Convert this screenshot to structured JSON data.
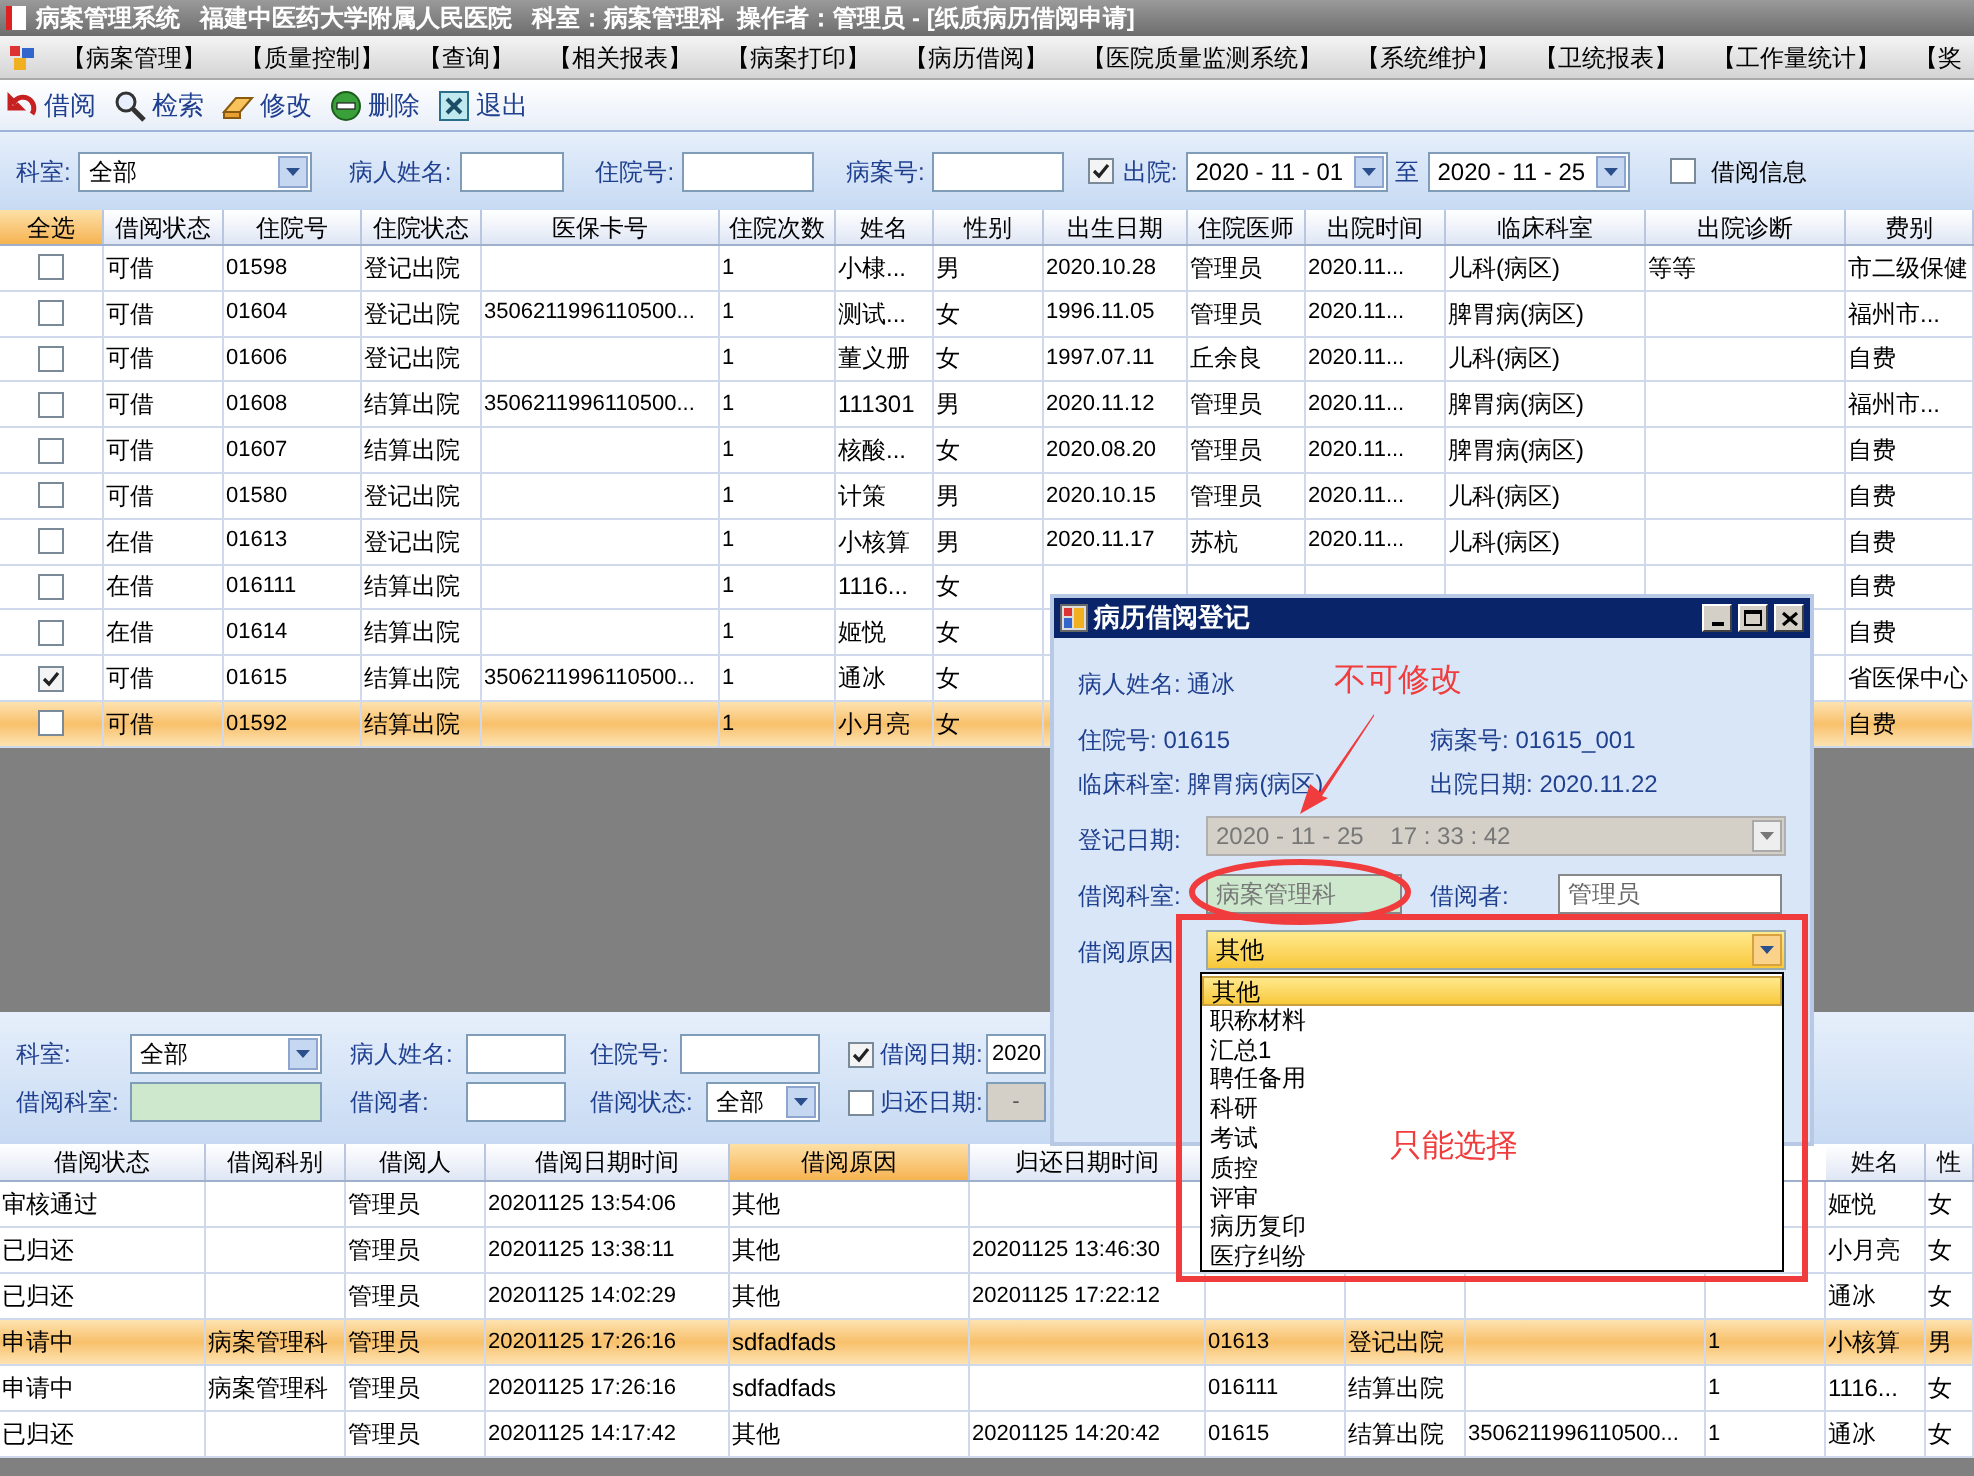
{
  "window": {
    "title": "病案管理系统   福建中医药大学附属人民医院   科室：病案管理科  操作者：管理员 - [纸质病历借阅申请]"
  },
  "menu": [
    "【病案管理】",
    "【质量控制】",
    "【查询】",
    "【相关报表】",
    "【病案打印】",
    "【病历借阅】",
    "【医院质量监测系统】",
    "【系统维护】",
    "【卫统报表】",
    "【工作量统计】",
    "【奖"
  ],
  "toolbar": [
    {
      "kind": "borrow",
      "label": "借阅"
    },
    {
      "kind": "search",
      "label": "检索"
    },
    {
      "kind": "edit",
      "label": "修改"
    },
    {
      "kind": "delete",
      "label": "删除"
    },
    {
      "kind": "exit",
      "label": "退出"
    }
  ],
  "filter": {
    "dept_label": "科室:",
    "dept": "全部",
    "name_label": "病人姓名:",
    "inpatient_label": "住院号:",
    "case_label": "病案号:",
    "discharge_checked": true,
    "discharge_label": "出院:",
    "date_from": "2020 - 11 - 01",
    "to_label": "至",
    "date_to": "2020 - 11 - 25",
    "borrow_info_checked": false,
    "borrow_info_label": "借阅信息"
  },
  "upper_table": {
    "select_all": {
      "label": "全选",
      "selected": true
    },
    "columns": [
      {
        "label": "借阅状态",
        "selected": false
      },
      {
        "label": "住院号",
        "selected": false
      },
      {
        "label": "住院状态",
        "selected": false
      },
      {
        "label": "医保卡号",
        "selected": false
      },
      {
        "label": "住院次数",
        "selected": false
      },
      {
        "label": "姓名",
        "selected": false
      },
      {
        "label": "性别",
        "selected": false
      },
      {
        "label": "出生日期",
        "selected": false
      },
      {
        "label": "住院医师",
        "selected": false
      },
      {
        "label": "出院时间",
        "selected": false
      },
      {
        "label": "临床科室",
        "selected": false
      },
      {
        "label": "出院诊断",
        "selected": false
      },
      {
        "label": "费别",
        "selected": false
      }
    ],
    "rows": [
      {
        "checked": false,
        "selected": false,
        "cells": [
          "可借",
          "01598",
          "登记出院",
          null,
          "1",
          "小棣...",
          "男",
          "2020.10.28",
          "管理员",
          "2020.11...",
          "儿科(病区)",
          "等等",
          "市二级保健"
        ]
      },
      {
        "checked": false,
        "selected": false,
        "cells": [
          "可借",
          "01604",
          "登记出院",
          "3506211996110500...",
          "1",
          "测试...",
          "女",
          "1996.11.05",
          "管理员",
          "2020.11...",
          "脾胃病(病区)",
          null,
          "福州市..."
        ]
      },
      {
        "checked": false,
        "selected": false,
        "cells": [
          "可借",
          "01606",
          "登记出院",
          null,
          "1",
          "董义册",
          "女",
          "1997.07.11",
          "丘余良",
          "2020.11...",
          "儿科(病区)",
          null,
          "自费"
        ]
      },
      {
        "checked": false,
        "selected": false,
        "cells": [
          "可借",
          "01608",
          "结算出院",
          "3506211996110500...",
          "1",
          "111301",
          "男",
          "2020.11.12",
          "管理员",
          "2020.11...",
          "脾胃病(病区)",
          null,
          "福州市..."
        ]
      },
      {
        "checked": false,
        "selected": false,
        "cells": [
          "可借",
          "01607",
          "结算出院",
          null,
          "1",
          "核酸...",
          "女",
          "2020.08.20",
          "管理员",
          "2020.11...",
          "脾胃病(病区)",
          null,
          "自费"
        ]
      },
      {
        "checked": false,
        "selected": false,
        "cells": [
          "可借",
          "01580",
          "登记出院",
          null,
          "1",
          "计策",
          "男",
          "2020.10.15",
          "管理员",
          "2020.11...",
          "儿科(病区)",
          null,
          "自费"
        ]
      },
      {
        "checked": false,
        "selected": false,
        "cells": [
          "在借",
          "01613",
          "登记出院",
          null,
          "1",
          "小核算",
          "男",
          "2020.11.17",
          "苏杭",
          "2020.11...",
          "儿科(病区)",
          null,
          "自费"
        ]
      },
      {
        "checked": false,
        "selected": false,
        "cells": [
          "在借",
          "016111",
          "结算出院",
          null,
          "1",
          "1116...",
          "女",
          null,
          null,
          null,
          null,
          null,
          "自费"
        ]
      },
      {
        "checked": false,
        "selected": false,
        "cells": [
          "在借",
          "01614",
          "结算出院",
          null,
          "1",
          "姬悦",
          "女",
          null,
          null,
          null,
          null,
          null,
          "自费"
        ]
      },
      {
        "checked": true,
        "selected": false,
        "cells": [
          "可借",
          "01615",
          "结算出院",
          "3506211996110500...",
          "1",
          "通冰",
          "女",
          null,
          null,
          null,
          null,
          null,
          "省医保中心"
        ]
      },
      {
        "checked": false,
        "selected": true,
        "cells": [
          "可借",
          "01592",
          "结算出院",
          null,
          "1",
          "小月亮",
          "女",
          null,
          null,
          null,
          null,
          null,
          "自费"
        ]
      }
    ]
  },
  "lower_filter": {
    "dept_label": "科室:",
    "dept": "全部",
    "name_label": "病人姓名:",
    "inpatient_label": "住院号:",
    "borrow_date_checked": true,
    "borrow_date_label": "借阅日期:",
    "borrow_date": "2020",
    "borrow_dept_label": "借阅科室:",
    "borrower_label": "借阅者:",
    "status_label": "借阅状态:",
    "status": "全部",
    "return_date_checked": false,
    "return_date_label": "归还日期:",
    "return_date": "-"
  },
  "lower_table": {
    "columns": [
      {
        "label": "借阅状态",
        "selected": false
      },
      {
        "label": "借阅科别",
        "selected": false
      },
      {
        "label": "借阅人",
        "selected": false
      },
      {
        "label": "借阅日期时间",
        "selected": false
      },
      {
        "label": "借阅原因",
        "selected": true
      },
      {
        "label": "归还日期时间",
        "selected": false
      },
      null,
      null,
      null,
      null,
      {
        "label": "姓名",
        "selected": false
      },
      {
        "label": "性",
        "selected": false
      }
    ],
    "rows": [
      {
        "selected": false,
        "cells": [
          "审核通过",
          null,
          "管理员",
          "20201125 13:54:06",
          "其他",
          null,
          null,
          null,
          null,
          null,
          "姬悦",
          "女"
        ]
      },
      {
        "selected": false,
        "cells": [
          "已归还",
          null,
          "管理员",
          "20201125 13:38:11",
          "其他",
          "20201125 13:46:30",
          null,
          null,
          null,
          null,
          "小月亮",
          "女"
        ]
      },
      {
        "selected": false,
        "cells": [
          "已归还",
          null,
          "管理员",
          "20201125 14:02:29",
          "其他",
          "20201125 17:22:12",
          null,
          null,
          null,
          null,
          "通冰",
          "女"
        ]
      },
      {
        "selected": true,
        "cells": [
          "申请中",
          "病案管理科",
          "管理员",
          "20201125 17:26:16",
          "sdfadfads",
          null,
          "01613",
          "登记出院",
          null,
          "1",
          "小核算",
          "男"
        ]
      },
      {
        "selected": false,
        "cells": [
          "申请中",
          "病案管理科",
          "管理员",
          "20201125 17:26:16",
          "sdfadfads",
          null,
          "016111",
          "结算出院",
          null,
          "1",
          "1116...",
          "女"
        ]
      },
      {
        "selected": false,
        "cells": [
          "已归还",
          null,
          "管理员",
          "20201125 14:17:42",
          "其他",
          "20201125 14:20:42",
          "01615",
          "结算出院",
          "3506211996110500...",
          "1",
          "通冰",
          "女"
        ]
      }
    ]
  },
  "dialog": {
    "title": "病历借阅登记",
    "info": [
      {
        "label": "病人姓名:",
        "value": "通冰"
      },
      {
        "label": "住院号:",
        "value": "01615"
      },
      {
        "label": "病案号:",
        "value": "01615_001"
      },
      {
        "label": "临床科室:",
        "value": "脾胃病(病区)"
      },
      {
        "label": "出院日期:",
        "value": "2020.11.22"
      }
    ],
    "register_date": {
      "label": "登记日期:",
      "value": "2020 - 11 - 25    17 : 33 : 42",
      "disabled": true
    },
    "borrow_dept": {
      "label": "借阅科室:",
      "value": "病案管理科",
      "disabled": true
    },
    "borrower": {
      "label": "借阅者:",
      "value": "管理员"
    },
    "reason": {
      "label": "借阅原因",
      "value": "其他",
      "expanded": true,
      "options": [
        {
          "label": "其他",
          "selected": true
        },
        {
          "label": "职称材料",
          "selected": false
        },
        {
          "label": "汇总1",
          "selected": false
        },
        {
          "label": "聘任备用",
          "selected": false
        },
        {
          "label": "科研",
          "selected": false
        },
        {
          "label": "考试",
          "selected": false
        },
        {
          "label": "质控",
          "selected": false
        },
        {
          "label": "评审",
          "selected": false
        },
        {
          "label": "病历复印",
          "selected": false
        },
        {
          "label": "医疗纠纷",
          "selected": false
        }
      ]
    }
  },
  "annotations": [
    {
      "kind": "locked",
      "text": "不可修改"
    },
    {
      "kind": "select_only",
      "text": "只能选择"
    }
  ]
}
